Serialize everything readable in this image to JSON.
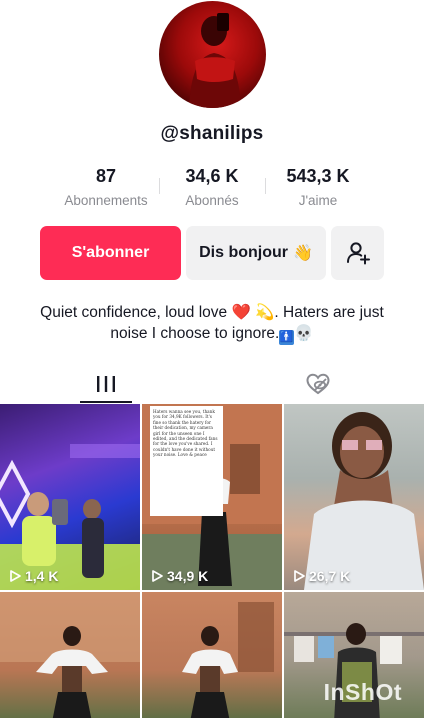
{
  "profile": {
    "username": "@shanilips",
    "avatar_icon": "profile-photo",
    "bio_text": "Quiet confidence, loud love",
    "bio_emoji_heart": "❤️",
    "bio_emoji_dizzy": "💫",
    "bio_text2": ". Haters are just noise I choose to ignore.",
    "bio_emoji_wc": "🚹",
    "bio_emoji_skull": "💀"
  },
  "stats": [
    {
      "value": "87",
      "label": "Abonnements"
    },
    {
      "value": "34,6 K",
      "label": "Abonnés"
    },
    {
      "value": "543,3 K",
      "label": "J'aime"
    }
  ],
  "actions": {
    "follow_label": "S'abonner",
    "hello_label": "Dis bonjour",
    "hello_emoji": "👋",
    "add_friend_icon": "add-user-icon"
  },
  "tabs": [
    {
      "icon": "videos-grid-icon",
      "active": true
    },
    {
      "icon": "liked-hidden-icon",
      "active": false
    }
  ],
  "videos": [
    {
      "views": "1,4 K"
    },
    {
      "views": "34,9 K",
      "caption": "Haters wanna see you, thank you for 34,9K followers. It's fine so thank the hatery for their dedication, my camera girl for the unseen one I edited, and the dedicated fans for the love you've shared. I couldn't have done it without your noise. Love & peace"
    },
    {
      "views": "26,7 K"
    },
    {
      "views": ""
    },
    {
      "views": ""
    },
    {
      "views": "",
      "watermark": "InShOt"
    }
  ],
  "colors": {
    "accent": "#fe2c55",
    "secondary_button": "#f1f1f2",
    "muted_text": "#8a8b91",
    "primary_text": "#161823"
  }
}
